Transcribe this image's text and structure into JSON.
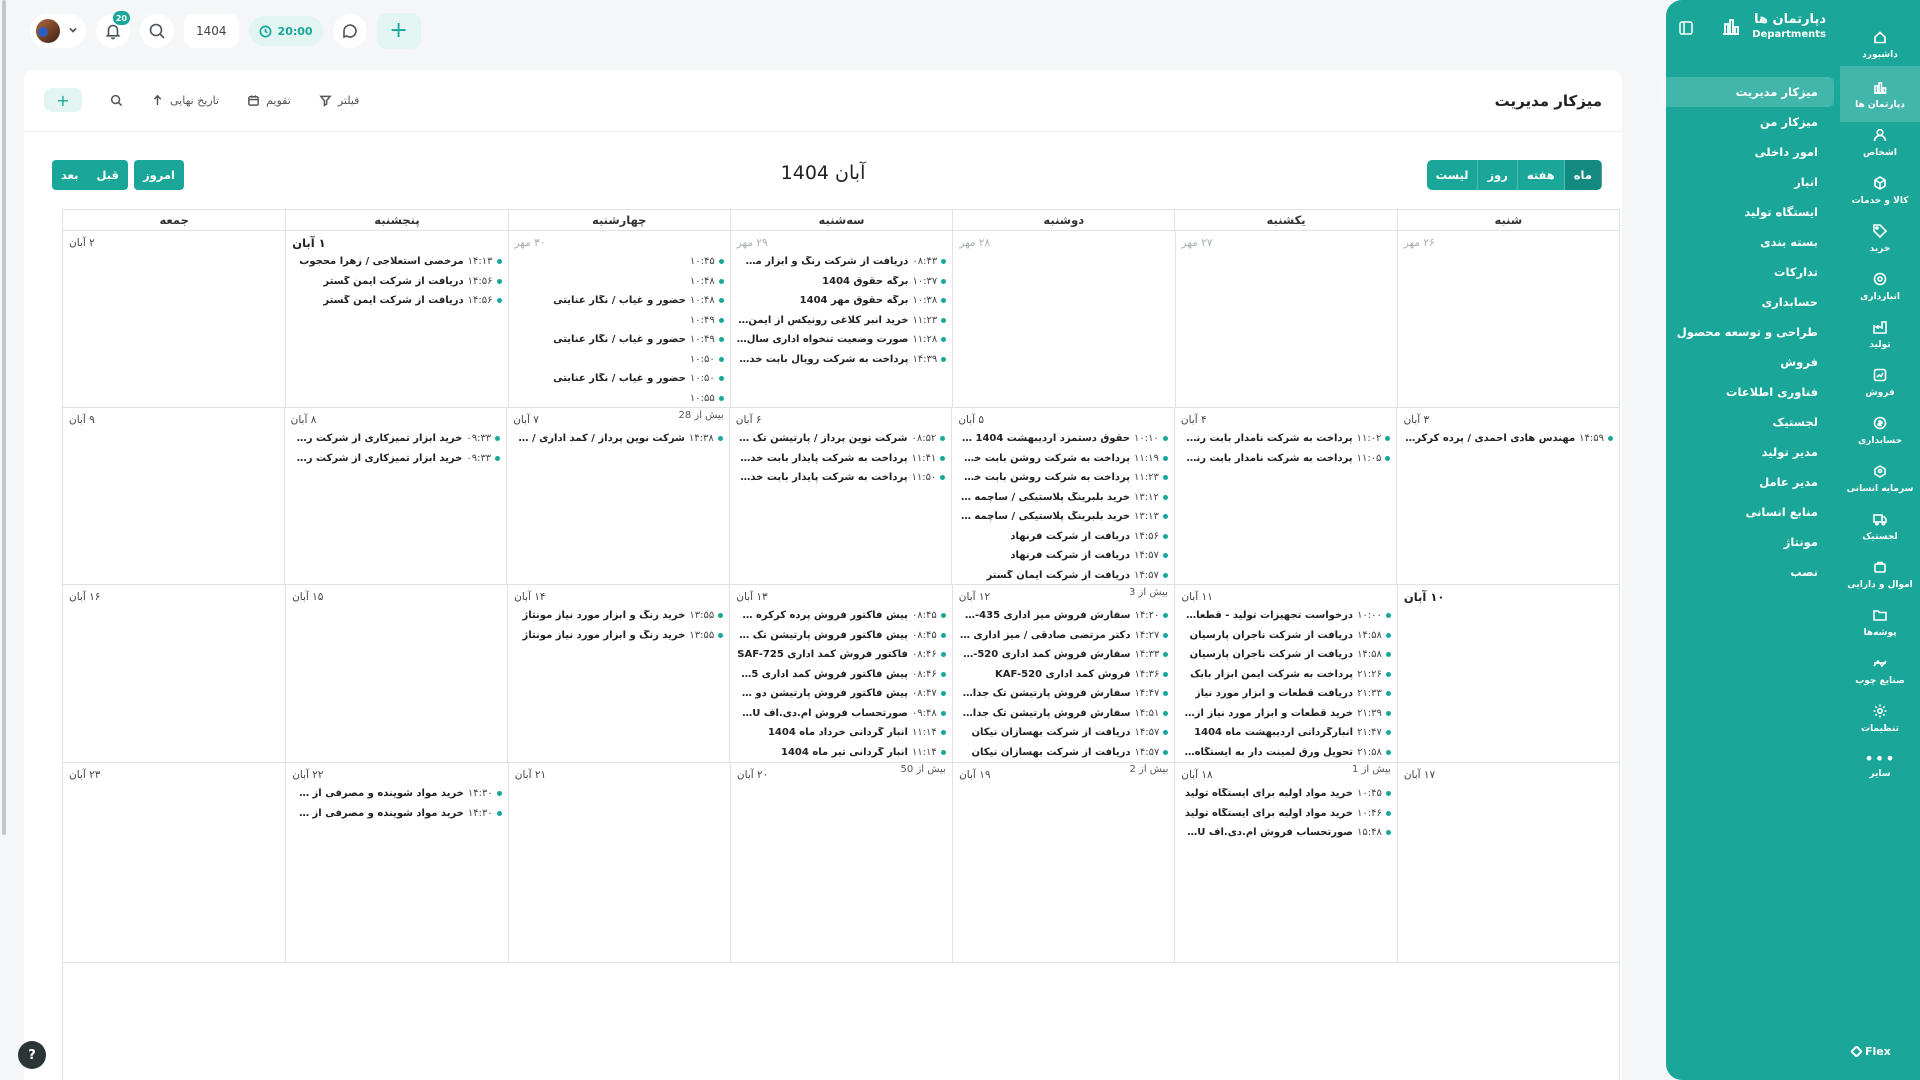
{
  "rail": [
    {
      "label": "داشبورد",
      "icon": "home-icon"
    },
    {
      "label": "دپارتمان ها",
      "icon": "departments-icon"
    },
    {
      "label": "اشخاص",
      "icon": "users-icon"
    },
    {
      "label": "کالا و خدمات",
      "icon": "box-icon"
    },
    {
      "label": "خرید",
      "icon": "tag-icon"
    },
    {
      "label": "انبارداری",
      "icon": "warehouse-icon"
    },
    {
      "label": "تولید",
      "icon": "factory-icon"
    },
    {
      "label": "فروش",
      "icon": "sales-icon"
    },
    {
      "label": "حسابداری",
      "icon": "coin-icon"
    },
    {
      "label": "سرمایه انسانی",
      "icon": "hr-icon"
    },
    {
      "label": "لجستیک",
      "icon": "truck-icon"
    },
    {
      "label": "اموال و دارایی",
      "icon": "asset-icon"
    },
    {
      "label": "پوشه‌ها",
      "icon": "folder-icon"
    },
    {
      "label": "صنایع چوب",
      "icon": "wood-icon"
    },
    {
      "label": "تنظیمات",
      "icon": "settings-icon"
    },
    {
      "label": "سایر",
      "icon": "more-icon"
    }
  ],
  "brand": "Flex",
  "dept": {
    "title_fa": "دپارتمان ها",
    "title_en": "Departments",
    "items": [
      "میزکار مدیریت",
      "میزکار من",
      "امور داخلی",
      "انبار",
      "ایستگاه تولید",
      "بسته بندی",
      "تدارکات",
      "حسابداری",
      "طراحی و توسعه محصول",
      "فروش",
      "فناوری اطلاعات",
      "لجستیک",
      "مدیر تولید",
      "مدیر عامل",
      "منابع انسانی",
      "مونتاژ",
      "نصب"
    ]
  },
  "topbar": {
    "notifications": "20",
    "year": "1404",
    "timer": "20:00"
  },
  "page": {
    "title": "میزکار مدیریت",
    "filter": "فیلتر",
    "calendar": "تقویم",
    "deadline": "تاریخ نهایی",
    "add": "+"
  },
  "calendar": {
    "title": "آبان 1404",
    "views": [
      "ماه",
      "هفته",
      "روز",
      "لیست"
    ],
    "today": "امروز",
    "prev": "قبل",
    "next": "بعد",
    "weekdays": [
      "شنبه",
      "یکشنبه",
      "دوشنبه",
      "سه‌شنبه",
      "چهارشنبه",
      "پنجشنبه",
      "جمعه"
    ],
    "weeks": [
      {
        "days": [
          {
            "num": "۲۶ مهر",
            "other": true,
            "events": []
          },
          {
            "num": "۲۷ مهر",
            "other": true,
            "events": []
          },
          {
            "num": "۲۸ مهر",
            "other": true,
            "events": []
          },
          {
            "num": "۲۹ مهر",
            "other": true,
            "events": [
              {
                "time": "۰۸:۴۳",
                "title": "دریافت از شرکت رنگ و ابزار مطهری"
              },
              {
                "time": "۱۰:۳۷",
                "title": "برگه حقوق 1404"
              },
              {
                "time": "۱۰:۳۸",
                "title": "برگه حقوق مهر 1404"
              },
              {
                "time": "۱۱:۲۳",
                "title": "خرید انبر کلاغی رونیکس از ایمن ابزار بابک"
              },
              {
                "time": "۱۱:۲۸",
                "title": "صورت وضعیت تنخواه اداری سال 1404"
              },
              {
                "time": "۱۴:۳۹",
                "title": "پرداخت به شرکت رویال بابت خدمات"
              }
            ]
          },
          {
            "num": "۳۰ مهر",
            "other": true,
            "events": [
              {
                "time": "۱۰:۴۵",
                "title": ""
              },
              {
                "time": "۱۰:۴۸",
                "title": ""
              },
              {
                "time": "۱۰:۴۸",
                "title": "حضور و غیاب / نگار عنایتی"
              },
              {
                "time": "۱۰:۴۹",
                "title": ""
              },
              {
                "time": "۱۰:۴۹",
                "title": "حضور و غیاب / نگار عنایتی"
              },
              {
                "time": "۱۰:۵۰",
                "title": ""
              },
              {
                "time": "۱۰:۵۰",
                "title": "حضور و غیاب / نگار عنایتی"
              },
              {
                "time": "۱۰:۵۵",
                "title": ""
              }
            ],
            "more": "بیش از 28"
          },
          {
            "num": "۱ آبان",
            "first": true,
            "events": [
              {
                "time": "۱۴:۱۳",
                "title": "مرخصی استعلاجی / زهرا محجوب"
              },
              {
                "time": "۱۴:۵۶",
                "title": "دریافت از شرکت ایمن گستر"
              },
              {
                "time": "۱۴:۵۶",
                "title": "دریافت از شرکت ایمن گستر"
              }
            ]
          },
          {
            "num": "۲ آبان",
            "events": []
          }
        ]
      },
      {
        "days": [
          {
            "num": "۳ آبان",
            "events": [
              {
                "time": "۱۴:۵۹",
                "title": "مهندس هادی احمدی / پرده کرکره سفید و ..."
              }
            ]
          },
          {
            "num": "۴ آبان",
            "events": [
              {
                "time": "۱۱:۰۲",
                "title": "پرداخت به شرکت نامدار بابت رنگ آمیزی"
              },
              {
                "time": "۱۱:۰۵",
                "title": "پرداخت به شرکت نامدار بابت رنگ آمیزی"
              }
            ]
          },
          {
            "num": "۵ آبان",
            "events": [
              {
                "time": "۱۰:۱۰",
                "title": "حقوق دستمزد اردیبهشت 1404 پرسنل نوادی"
              },
              {
                "time": "۱۱:۱۹",
                "title": "پرداخت به شرکت روشن بابت خرید لوازم اداری"
              },
              {
                "time": "۱۱:۲۳",
                "title": "پرداخت به شرکت روشن بابت خرید لوازم ادا..."
              },
              {
                "time": "۱۳:۱۲",
                "title": "خرید بلبرینگ پلاستیکی / ساچمه ای از شرک..."
              },
              {
                "time": "۱۳:۱۳",
                "title": "خرید بلبرینگ پلاستیکی / ساچمه ای از شرک..."
              },
              {
                "time": "۱۴:۵۶",
                "title": "دریافت از شرکت فرنهاد"
              },
              {
                "time": "۱۴:۵۷",
                "title": "دریافت از شرکت فرنهاد"
              },
              {
                "time": "۱۴:۵۷",
                "title": "دریافت از شرکت ایمان گستر"
              }
            ],
            "more": "بیش از 3"
          },
          {
            "num": "۶ آبان",
            "events": [
              {
                "time": "۰۸:۵۲",
                "title": "شرکت نوین پرداز / پارتیشن تک جداره / ک ..."
              },
              {
                "time": "۱۱:۴۱",
                "title": "پرداخت به شرکت پایدار بابت خدمات ارتباطی"
              },
              {
                "time": "۱۱:۵۰",
                "title": "پرداخت به شرکت پایدار بابت خدمات ارتباطی"
              }
            ]
          },
          {
            "num": "۷ آبان",
            "events": [
              {
                "time": "۱۴:۳۸",
                "title": "شرکت نوین پرداز / کمد اداری / ک پ 16335"
              }
            ]
          },
          {
            "num": "۸ آبان",
            "events": [
              {
                "time": "۰۹:۳۳",
                "title": "خرید ابزار تمیزکاری از شرکت رویال"
              },
              {
                "time": "۰۹:۳۳",
                "title": "خرید ابزار تمیزکاری از شرکت رویال"
              }
            ]
          },
          {
            "num": "۹ آبان",
            "events": []
          }
        ]
      },
      {
        "days": [
          {
            "num": "۱۰ آبان",
            "today": true,
            "events": []
          },
          {
            "num": "۱۱ آبان",
            "events": [
              {
                "time": "۱۰:۰۰",
                "title": "درخواست تجهیزات تولید - قطعات و ابزار م..."
              },
              {
                "time": "۱۴:۵۸",
                "title": "دریافت از شرکت ناجران پارسیان"
              },
              {
                "time": "۱۴:۵۸",
                "title": "دریافت از شرکت ناجران پارسیان"
              },
              {
                "time": "۲۱:۲۶",
                "title": "پرداخت به شرکت ایمن ابزار بابک"
              },
              {
                "time": "۲۱:۳۳",
                "title": "دریافت قطعات و ابزار مورد نیاز"
              },
              {
                "time": "۲۱:۳۹",
                "title": "خرید قطعات و ابزار مورد نیاز از ایمن ابزار با..."
              },
              {
                "time": "۲۱:۴۷",
                "title": "انبارگردانی اردیبهشت ماه 1404"
              },
              {
                "time": "۲۱:۵۸",
                "title": "تحویل ورق لمینت دار به ایستگاه تولیدی"
              }
            ],
            "more": "بیش از 1"
          },
          {
            "num": "۱۲ آبان",
            "events": [
              {
                "time": "۱۴:۲۰",
                "title": "سفارش فروش میز اداری BAG-435"
              },
              {
                "time": "۱۴:۲۷",
                "title": "دکتر مرتضی صادقی / میز اداری / ک پ 320..."
              },
              {
                "time": "۱۴:۳۳",
                "title": "سفارش فروش کمد اداری KAF-520"
              },
              {
                "time": "۱۴:۳۶",
                "title": "فروش کمد اداری KAF-520"
              },
              {
                "time": "۱۴:۴۷",
                "title": "سفارش فروش پارتیشن تک جداره 7534-..."
              },
              {
                "time": "۱۴:۵۱",
                "title": "سفارش فروش پارتیشن تک جداره PAR-7534"
              },
              {
                "time": "۱۴:۵۷",
                "title": "دریافت از شرکت بهسازان نیکان"
              },
              {
                "time": "۱۴:۵۷",
                "title": "دریافت از شرکت بهسازان نیکان"
              }
            ],
            "more": "بیش از 2"
          },
          {
            "num": "۱۳ آبان",
            "events": [
              {
                "time": "۰۸:۴۵",
                "title": "پیش فاکتور فروش پرده کرکره خاکستری ..."
              },
              {
                "time": "۰۸:۴۵",
                "title": "پیش فاکتور فروش پارتیشن تک جداره 34..."
              },
              {
                "time": "۰۸:۴۶",
                "title": "فاکتور فروش کمد اداری SAF-725"
              },
              {
                "time": "۰۸:۴۶",
                "title": "پیش فاکتور فروش کمد اداری SAF-725"
              },
              {
                "time": "۰۸:۴۷",
                "title": "پیش فاکتور فروش پارتیشن دو جداره 54..."
              },
              {
                "time": "۰۹:۴۸",
                "title": "صورتحساب فروش ام.دی.اف CL&PU"
              },
              {
                "time": "۱۱:۱۴",
                "title": "انبار گردانی خرداد ماه 1404"
              },
              {
                "time": "۱۱:۱۴",
                "title": "انبار گردانی تیر ماه 1404"
              }
            ],
            "more": "بیش از 50"
          },
          {
            "num": "۱۴ آبان",
            "events": [
              {
                "time": "۱۳:۵۵",
                "title": "خرید رنگ و ابزار مورد نیاز مونتاژ"
              },
              {
                "time": "۱۳:۵۵",
                "title": "خرید رنگ و ابزار مورد نیاز مونتاژ"
              }
            ]
          },
          {
            "num": "۱۵ آبان",
            "events": []
          },
          {
            "num": "۱۶ آبان",
            "events": []
          }
        ]
      },
      {
        "days": [
          {
            "num": "۱۷ آبان",
            "events": []
          },
          {
            "num": "۱۸ آبان",
            "events": [
              {
                "time": "۱۰:۴۵",
                "title": "خرید مواد اولیه برای ایستگاه تولید"
              },
              {
                "time": "۱۰:۴۶",
                "title": "خرید مواد اولیه برای ایستگاه تولید"
              },
              {
                "time": "۱۵:۴۸",
                "title": "صورتحساب فروش ام.دی.اف CL&PU"
              }
            ]
          },
          {
            "num": "۱۹ آبان",
            "events": []
          },
          {
            "num": "۲۰ آبان",
            "events": []
          },
          {
            "num": "۲۱ آبان",
            "events": []
          },
          {
            "num": "۲۲ آبان",
            "events": [
              {
                "time": "۱۴:۳۰",
                "title": "خرید مواد شوینده و مصرفی از شرکت رویال"
              },
              {
                "time": "۱۴:۳۰",
                "title": "خرید مواد شوینده و مصرفی از شرکت رویال"
              }
            ]
          },
          {
            "num": "۲۳ آبان",
            "events": []
          }
        ]
      }
    ]
  },
  "help": "?"
}
